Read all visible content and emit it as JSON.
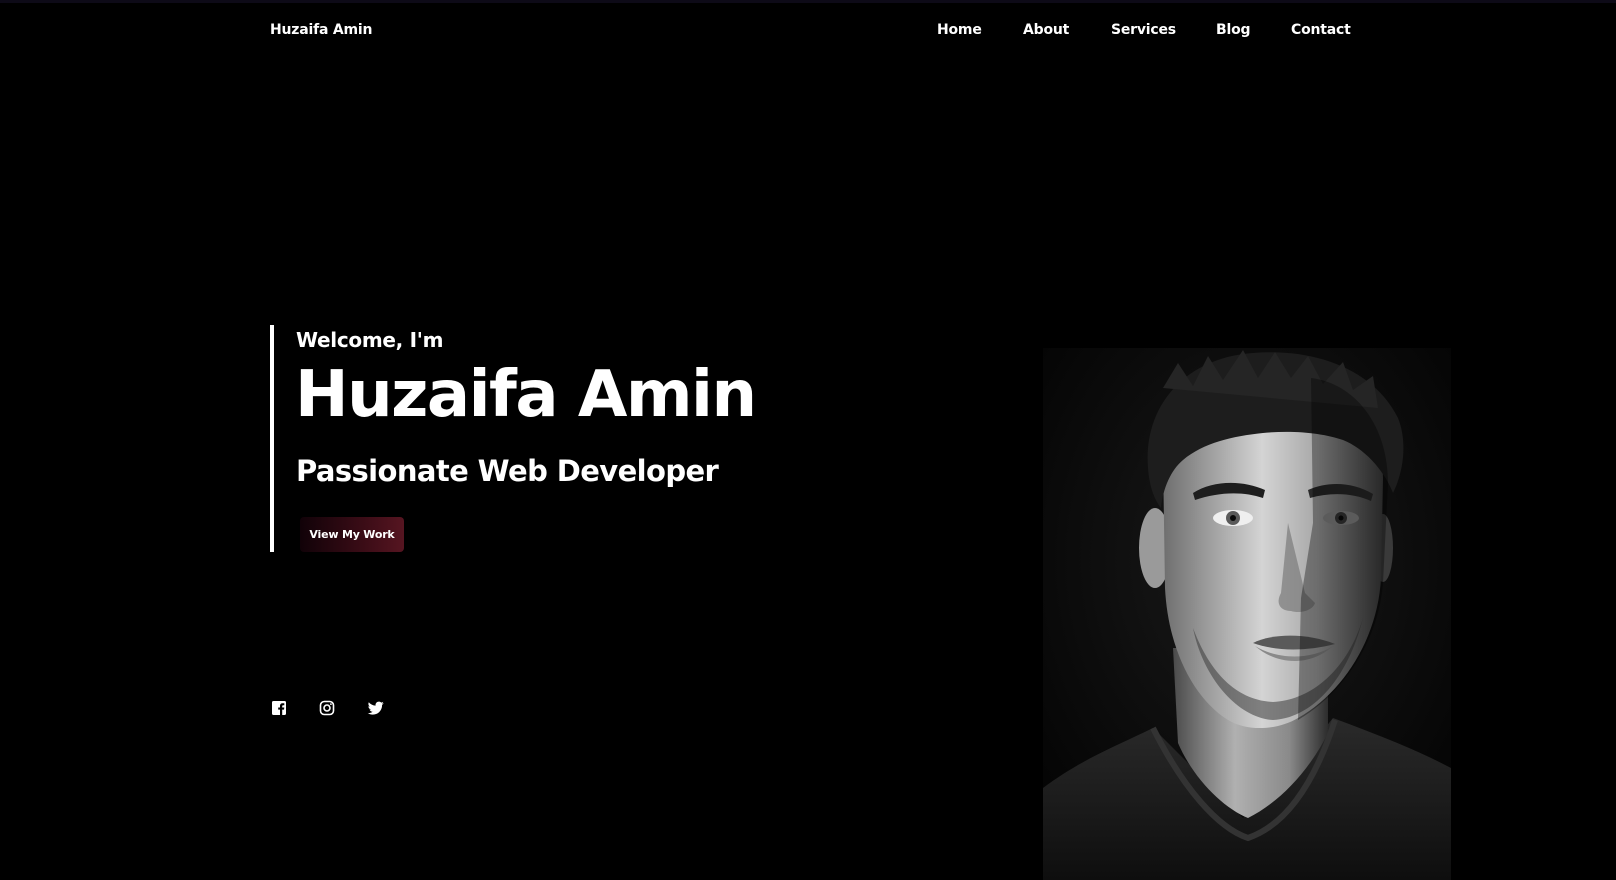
{
  "brand": "Huzaifa Amin",
  "nav": {
    "home": "Home",
    "about": "About",
    "services": "Services",
    "blog": "Blog",
    "contact": "Contact"
  },
  "hero": {
    "greeting": "Welcome, I'm",
    "name": "Huzaifa Amin",
    "role": "Passionate Web Developer",
    "cta_label": "View My Work"
  },
  "socials": [
    "facebook-icon",
    "instagram-icon",
    "twitter-icon"
  ],
  "colors": {
    "background": "#000000",
    "text": "#ffffff",
    "button_gradient_start": "#110208",
    "button_gradient_end": "#561521"
  }
}
